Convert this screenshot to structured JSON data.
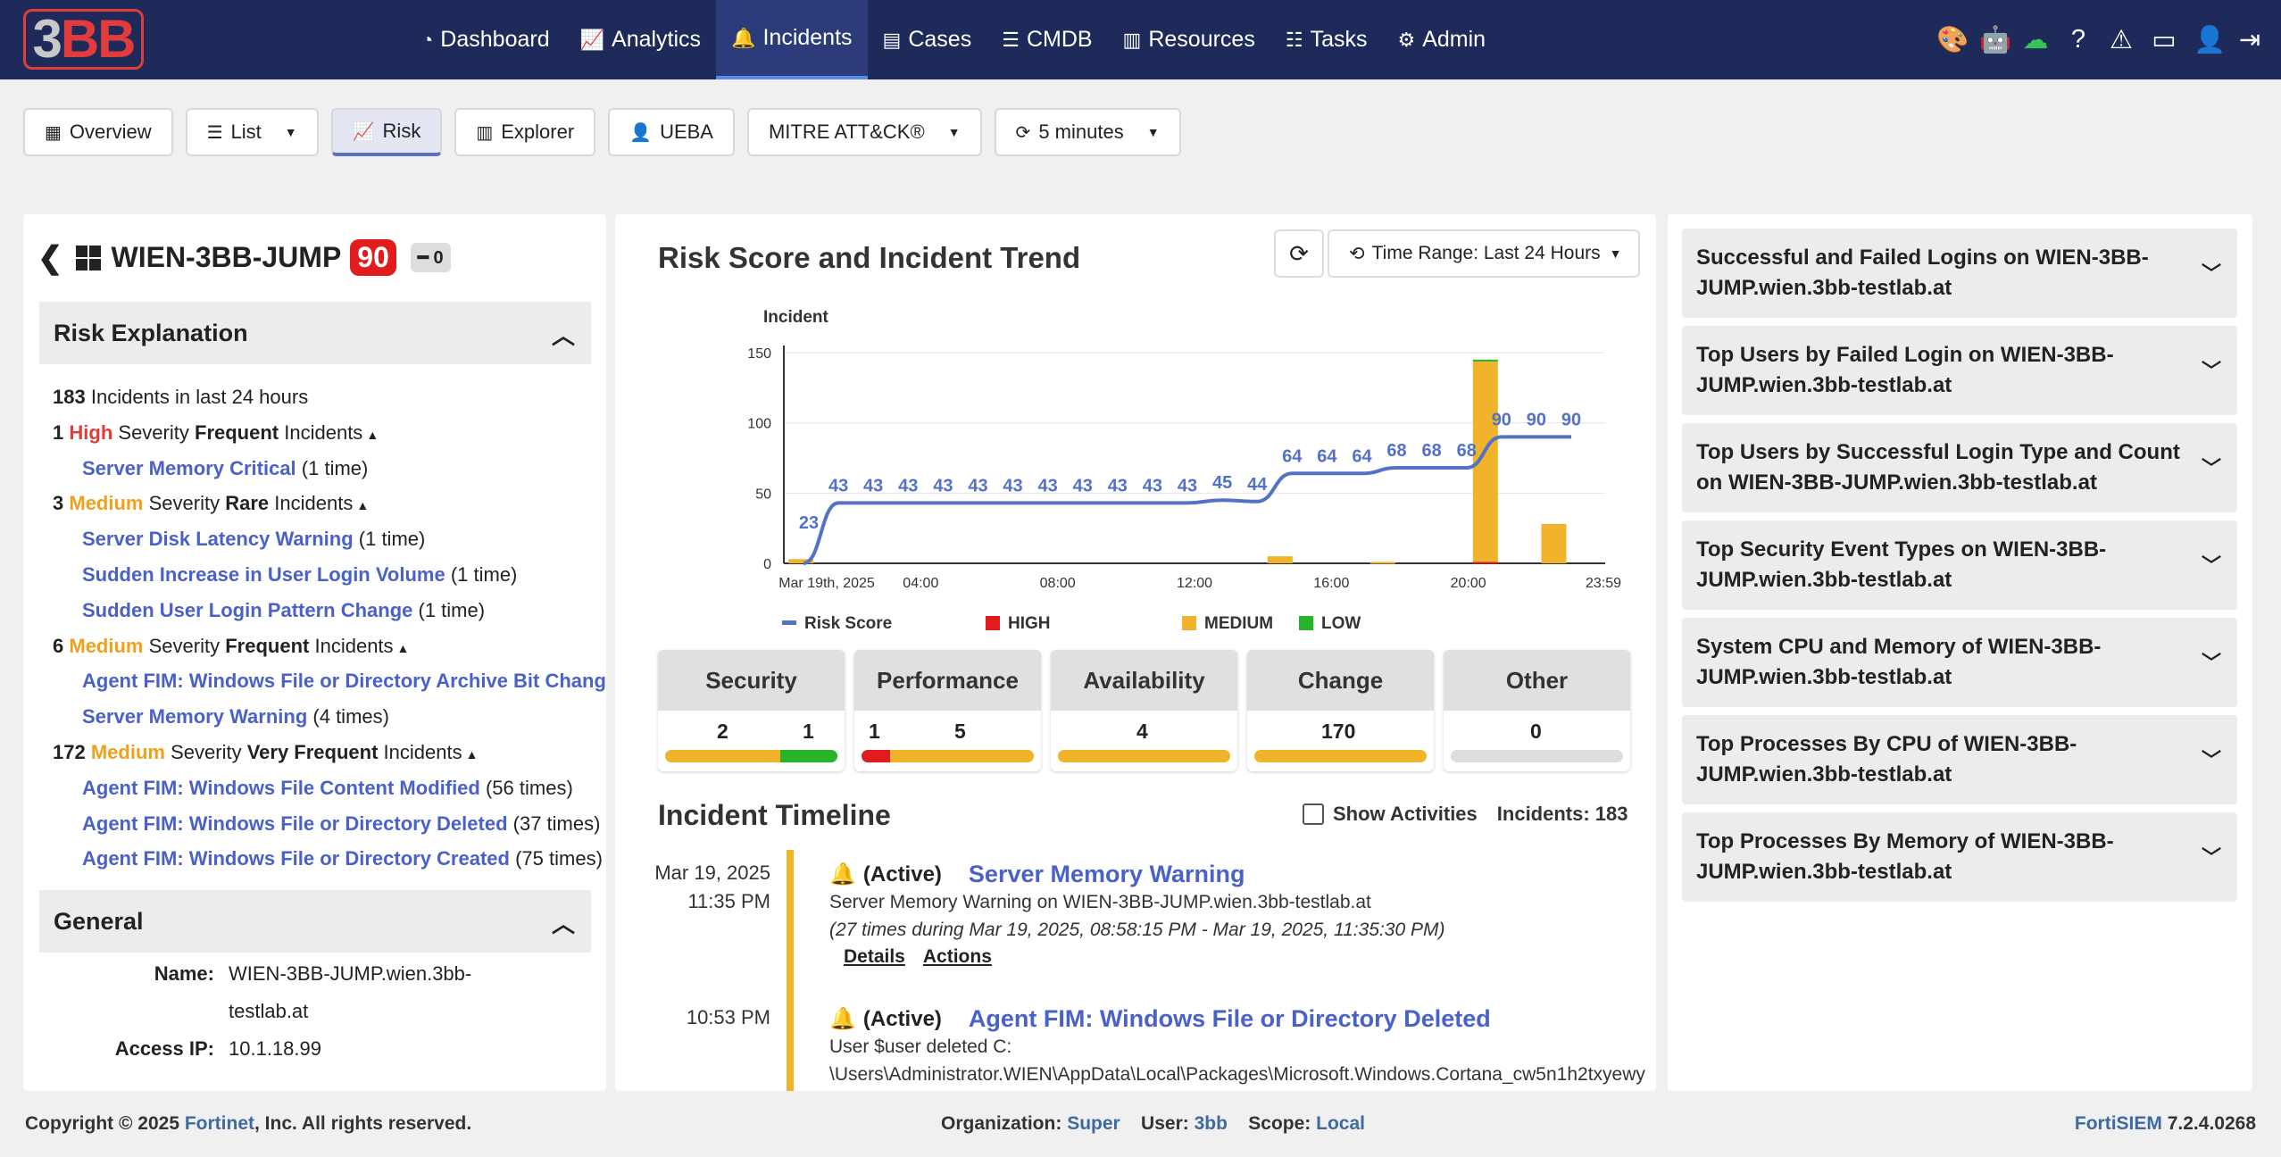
{
  "logo": "3BB",
  "nav": [
    {
      "label": "Dashboard",
      "icon": "dashboard-icon"
    },
    {
      "label": "Analytics",
      "icon": "chart-icon"
    },
    {
      "label": "Incidents",
      "icon": "bell-icon",
      "active": true
    },
    {
      "label": "Cases",
      "icon": "archive-icon"
    },
    {
      "label": "CMDB",
      "icon": "database-icon"
    },
    {
      "label": "Resources",
      "icon": "bar-chart-icon"
    },
    {
      "label": "Tasks",
      "icon": "tasks-icon"
    },
    {
      "label": "Admin",
      "icon": "cogs-icon"
    }
  ],
  "tabs": {
    "overview": "Overview",
    "list": "List",
    "risk": "Risk",
    "explorer": "Explorer",
    "ueba": "UEBA",
    "mitre": "MITRE ATT&CK®",
    "refresh": "5 minutes"
  },
  "device": {
    "name": "WIEN-3BB-JUMP",
    "risk_score": "90",
    "chip_count": "0"
  },
  "risk_explanation": {
    "title": "Risk Explanation",
    "total_count": "183",
    "total_text": "Incidents in last 24 hours",
    "groups": [
      {
        "count": "1",
        "severity": "High",
        "sev_class": "high",
        "word": "Severity",
        "freq": "Frequent",
        "suffix": "Incidents",
        "items": [
          {
            "name": "Server Memory Critical",
            "times": "(1 time)"
          }
        ]
      },
      {
        "count": "3",
        "severity": "Medium",
        "sev_class": "med",
        "word": "Severity",
        "freq": "Rare",
        "suffix": "Incidents",
        "items": [
          {
            "name": "Server Disk Latency Warning",
            "times": "(1 time)"
          },
          {
            "name": "Sudden Increase in User Login Volume",
            "times": "(1 time)"
          },
          {
            "name": "Sudden User Login Pattern Change",
            "times": "(1 time)"
          }
        ]
      },
      {
        "count": "6",
        "severity": "Medium",
        "sev_class": "med",
        "word": "Severity",
        "freq": "Frequent",
        "suffix": "Incidents",
        "items": [
          {
            "name": "Agent FIM: Windows File or Directory Archive Bit Changed",
            "times": ""
          },
          {
            "name": "Server Memory Warning",
            "times": "(4 times)"
          }
        ]
      },
      {
        "count": "172",
        "severity": "Medium",
        "sev_class": "med",
        "word": "Severity",
        "freq": "Very Frequent",
        "suffix": "Incidents",
        "items": [
          {
            "name": "Agent FIM: Windows File Content Modified",
            "times": "(56 times)"
          },
          {
            "name": "Agent FIM: Windows File or Directory Deleted",
            "times": "(37 times)"
          },
          {
            "name": "Agent FIM: Windows File or Directory Created",
            "times": "(75 times)"
          }
        ]
      }
    ]
  },
  "general": {
    "title": "General",
    "name_label": "Name:",
    "name_value": "WIEN-3BB-JUMP.wien.3bb-testlab.at",
    "ip_label": "Access IP:",
    "ip_value": "10.1.18.99"
  },
  "chart_header": {
    "title": "Risk Score and Incident Trend",
    "time_range": "Time Range: Last 24 Hours"
  },
  "chart_data": {
    "type": "bar",
    "ylabel": "Incident",
    "ylim": [
      0,
      150
    ],
    "yticks": [
      0,
      50,
      100,
      150
    ],
    "x_tick_labels": [
      "Mar 19th, 2025",
      "04:00",
      "08:00",
      "12:00",
      "16:00",
      "20:00",
      "23:59"
    ],
    "risk_score_series": {
      "name": "Risk Score",
      "labels": [
        "23",
        "43",
        "43",
        "43",
        "43",
        "43",
        "43",
        "43",
        "43",
        "43",
        "43",
        "43",
        "45",
        "44",
        "64",
        "64",
        "64",
        "68",
        "68",
        "68",
        "90",
        "90",
        "90"
      ],
      "values": [
        0,
        43,
        43,
        43,
        43,
        43,
        43,
        43,
        43,
        43,
        43,
        43,
        45,
        44,
        64,
        64,
        64,
        68,
        68,
        68,
        90,
        90,
        90
      ]
    },
    "bars": [
      {
        "hour": 1,
        "medium": 3
      },
      {
        "hour": 15,
        "medium": 5
      },
      {
        "hour": 18,
        "medium": 1
      },
      {
        "hour": 21,
        "medium": 143,
        "high": 1,
        "low": 1
      },
      {
        "hour": 23,
        "medium": 28
      }
    ],
    "legend": [
      {
        "name": "Risk Score",
        "color": "#5471c8"
      },
      {
        "name": "HIGH",
        "color": "#e21c1c"
      },
      {
        "name": "MEDIUM",
        "color": "#f0b32a"
      },
      {
        "name": "LOW",
        "color": "#28b428"
      }
    ],
    "grid": true
  },
  "categories": [
    {
      "name": "Security",
      "a": "2",
      "b": "1",
      "fill": [
        [
          "#f0b32a",
          2
        ],
        [
          "#28b428",
          1
        ]
      ]
    },
    {
      "name": "Performance",
      "a": "1",
      "b": "5",
      "fill": [
        [
          "#e21c1c",
          1
        ],
        [
          "#f0b32a",
          5
        ]
      ]
    },
    {
      "name": "Availability",
      "a": "4",
      "b": "",
      "fill": [
        [
          "#f0b32a",
          1
        ]
      ]
    },
    {
      "name": "Change",
      "a": "170",
      "b": "",
      "fill": [
        [
          "#f0b32a",
          1
        ]
      ]
    },
    {
      "name": "Other",
      "a": "0",
      "b": "",
      "fill": []
    }
  ],
  "timeline": {
    "title": "Incident Timeline",
    "show_activities": "Show Activities",
    "incidents_count": "Incidents: 183",
    "entries": [
      {
        "date": "Mar 19, 2025",
        "time": "11:35 PM",
        "state": "(Active)",
        "title": "Server Memory Warning",
        "desc1": "Server Memory Warning on WIEN-3BB-JUMP.wien.3bb-testlab.at",
        "desc2": "(27 times during Mar 19, 2025, 08:58:15 PM - Mar 19, 2025, 11:35:30 PM)",
        "details": "Details",
        "actions": "Actions"
      },
      {
        "date": "",
        "time": "10:53 PM",
        "state": "(Active)",
        "title": "Agent FIM: Windows File or Directory Deleted",
        "desc1": "User $user deleted C:",
        "desc2": "\\Users\\Administrator.WIEN\\AppData\\Local\\Packages\\Microsoft.Windows.Cortana_cw5n1h2txyewy"
      }
    ]
  },
  "right_cards": [
    "Successful and Failed Logins on WIEN-3BB-JUMP.wien.3bb-testlab.at",
    "Top Users by Failed Login on WIEN-3BB-JUMP.wien.3bb-testlab.at",
    "Top Users by Successful Login Type and Count on WIEN-3BB-JUMP.wien.3bb-testlab.at",
    "Top Security Event Types on WIEN-3BB-JUMP.wien.3bb-testlab.at",
    "System CPU and Memory of WIEN-3BB-JUMP.wien.3bb-testlab.at",
    "Top Processes By CPU of WIEN-3BB-JUMP.wien.3bb-testlab.at",
    "Top Processes By Memory of WIEN-3BB-JUMP.wien.3bb-testlab.at"
  ],
  "footer": {
    "copyright_pre": "Copyright © 2025 ",
    "company": "Fortinet",
    "copyright_post": ", Inc. All rights reserved.",
    "org_label": "Organization:",
    "org_value": "Super",
    "user_label": "User:",
    "user_value": "3bb",
    "scope_label": "Scope:",
    "scope_value": "Local",
    "product": "FortiSIEM",
    "version": "7.2.4.0268"
  }
}
